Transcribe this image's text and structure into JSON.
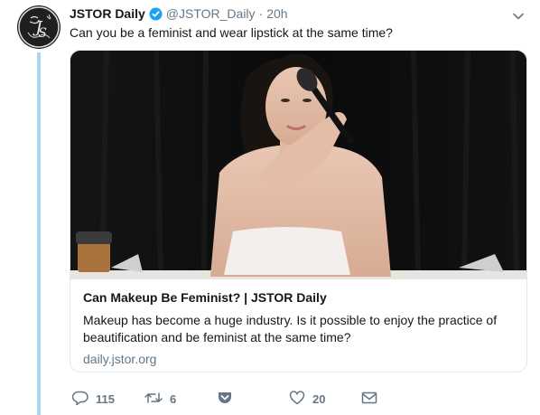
{
  "tweet": {
    "display_name": "JSTOR Daily",
    "handle": "@JSTOR_Daily",
    "separator": "·",
    "time": "20h",
    "text": "Can you be a feminist and wear lipstick at the same time?",
    "verified": true,
    "avatar_icon": "jstor-monogram-logo"
  },
  "card": {
    "title": "Can Makeup Be Feminist? | JSTOR Daily",
    "description_line1": "Makeup has become a huge industry. Is it possible to enjoy the practice of",
    "description_line2": "beautification and be feminist at the same time?",
    "domain": "daily.jstor.org",
    "image_icon": "photo-woman-applying-makeup"
  },
  "actions": {
    "reply_count": "115",
    "retweet_count": "6",
    "like_count": "20"
  },
  "colors": {
    "accent": "#1da1f2",
    "thread_line": "#a9d6ef",
    "muted": "#657786"
  }
}
